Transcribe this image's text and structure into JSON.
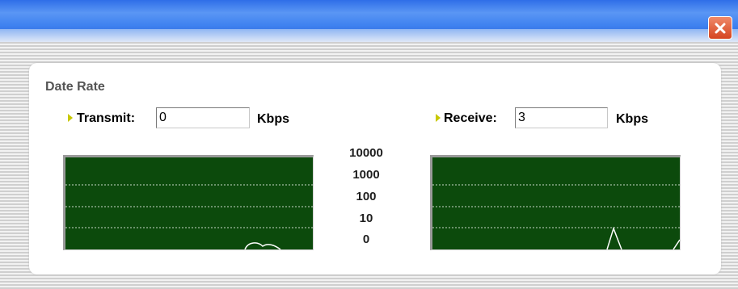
{
  "window": {
    "close_icon": "close-icon",
    "close_color": "#d5441f"
  },
  "section": {
    "title": "Date Rate"
  },
  "transmit": {
    "label": "Transmit:",
    "value": "0",
    "unit": "Kbps"
  },
  "receive": {
    "label": "Receive:",
    "value": "3",
    "unit": "Kbps"
  },
  "scale": {
    "labels": [
      "10000",
      "1000",
      "100",
      "10",
      "0"
    ]
  },
  "colors": {
    "graph_bg": "#0c4a0c",
    "grid": "#c8d8c8",
    "trace": "#ffffff",
    "bullet": "#c8c800"
  }
}
